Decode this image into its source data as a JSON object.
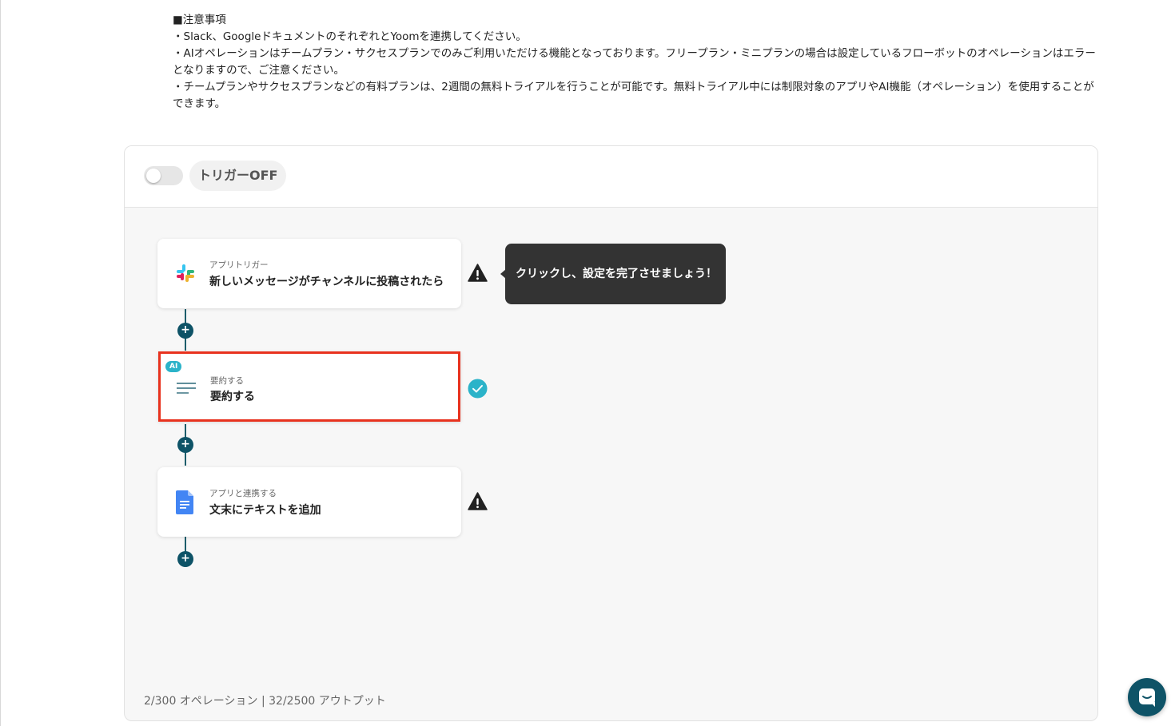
{
  "notes": {
    "heading": "■注意事項",
    "line1": "・Slack、GoogleドキュメントのそれぞれとYoomを連携してください。",
    "line2": "・AIオペレーションはチームプラン・サクセスプランでのみご利用いただける機能となっております。フリープラン・ミニプランの場合は設定しているフローボットのオペレーションはエラーとなりますので、ご注意ください。",
    "line3": "・チームプランやサクセスプランなどの有料プランは、2週間の無料トライアルを行うことが可能です。無料トライアル中には制限対象のアプリやAI機能（オペレーション）を使用することができます。"
  },
  "panel": {
    "trigger_label": "トリガーOFF",
    "trigger_on": false,
    "usage": "2/300 オペレーション | 32/2500 アウトプット"
  },
  "steps": [
    {
      "sub": "アプリトリガー",
      "title": "新しいメッセージがチャンネルに投稿されたら",
      "icon": "slack-icon",
      "status": "warning-icon"
    },
    {
      "sub": "要約する",
      "title": "要約する",
      "icon": "summary-lines-icon",
      "status": "check-circle-icon",
      "badge": "AI"
    },
    {
      "sub": "アプリと連携する",
      "title": "文末にテキストを追加",
      "icon": "google-docs-icon",
      "status": "warning-icon"
    }
  ],
  "tooltip": {
    "text": "クリックし、設定を完了させましょう！"
  },
  "plus_symbol": "+",
  "colors": {
    "accent": "#0e5367",
    "selected_border": "#e8321e",
    "check": "#2bb3c9",
    "tooltip_bg": "#333333"
  }
}
